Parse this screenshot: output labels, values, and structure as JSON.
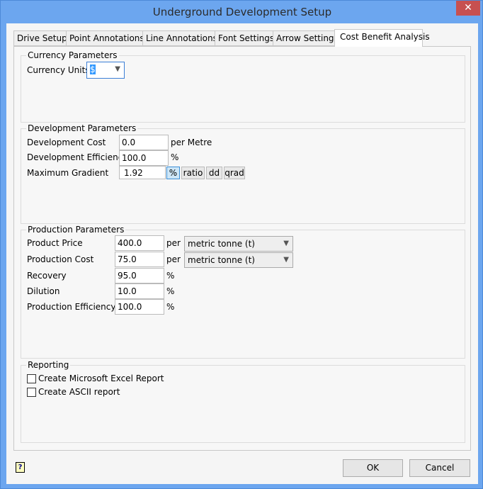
{
  "window": {
    "title": "Underground Development Setup",
    "close_icon": "close-icon"
  },
  "tabs": [
    "Drive Setup",
    "Point Annotations",
    "Line Annotations",
    "Font Settings",
    "Arrow Settings",
    "Cost Benefit Analysis"
  ],
  "active_tab": "Cost Benefit Analysis",
  "currency": {
    "group": "Currency Parameters",
    "units_label": "Currency Units",
    "units_value": "$"
  },
  "development": {
    "group": "Development Parameters",
    "cost_label": "Development Cost",
    "cost_value": "0.0",
    "cost_unit": "per Metre",
    "eff_label": "Development Efficiency",
    "eff_value": "100.0",
    "eff_unit": "%",
    "grad_label": "Maximum Gradient",
    "grad_value": "1.92",
    "grad_units": [
      "%",
      "ratio",
      "dd",
      "qrad"
    ],
    "grad_selected": "%"
  },
  "production": {
    "group": "Production Parameters",
    "price_label": "Product Price",
    "price_value": "400.0",
    "per": "per",
    "price_unit": "metric tonne (t)",
    "cost_label": "Production Cost",
    "cost_value": "75.0",
    "cost_unit": "metric tonne (t)",
    "recovery_label": "Recovery",
    "recovery_value": "95.0",
    "dilution_label": "Dilution",
    "dilution_value": "10.0",
    "eff_label": "Production Efficiency",
    "eff_value": "100.0",
    "pct": "%"
  },
  "reporting": {
    "group": "Reporting",
    "excel_label": "Create Microsoft Excel Report",
    "excel_checked": false,
    "ascii_label": "Create ASCII report",
    "ascii_checked": false
  },
  "buttons": {
    "ok": "OK",
    "cancel": "Cancel",
    "help_icon": "help-icon"
  }
}
